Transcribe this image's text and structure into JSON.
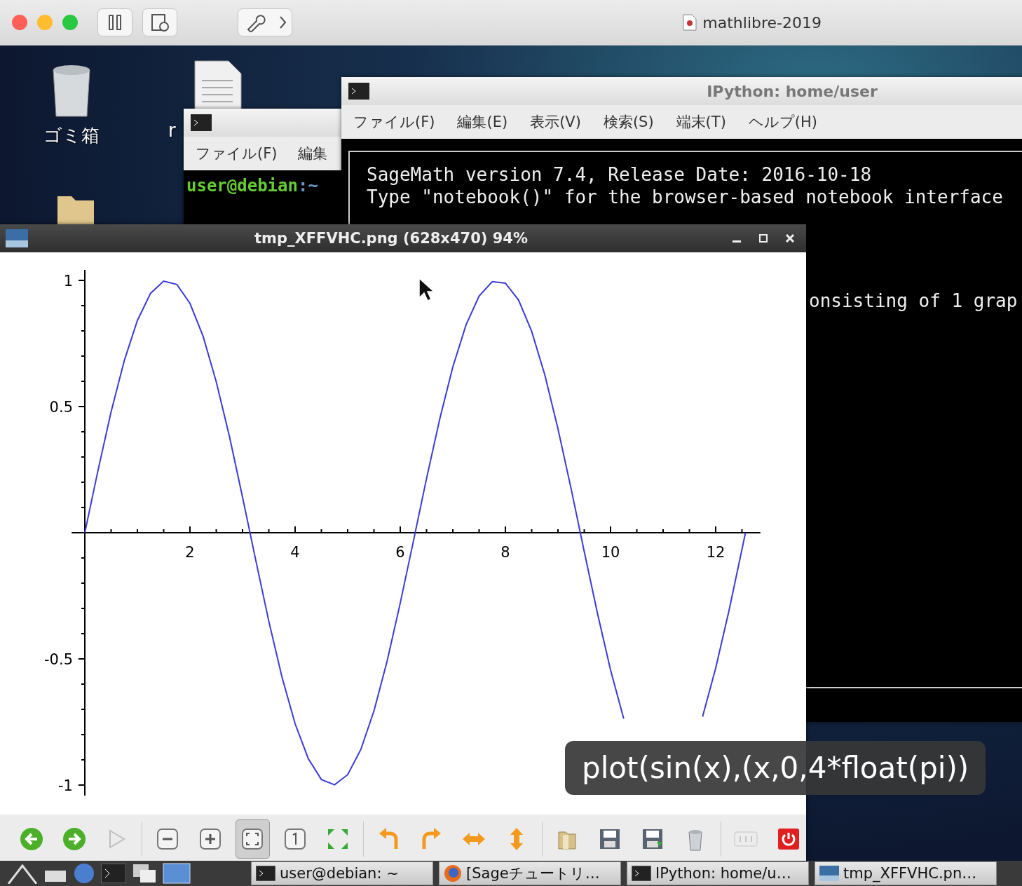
{
  "host_toolbar": {
    "title": "mathlibre-2019"
  },
  "desktop_icons": [
    {
      "kind": "trash",
      "label": "ゴミ箱"
    },
    {
      "kind": "document",
      "label": "r"
    },
    {
      "kind": "folder"
    }
  ],
  "small_terminal": {
    "menus": [
      "ファイル(F)",
      "編集"
    ],
    "prompt_user": "user@debian",
    "prompt_path": ":~"
  },
  "ipython_window": {
    "title": "IPython: home/user",
    "menus": [
      "ファイル(F)",
      "編集(E)",
      "表示(V)",
      "検索(S)",
      "端末(T)",
      "ヘルプ(H)"
    ],
    "lines": [
      "SageMath version 7.4, Release Date: 2016-10-18",
      "Type \"notebook()\" for the browser-based notebook interface"
    ],
    "partial_line": "onsisting of 1 grap"
  },
  "image_viewer": {
    "title": "tmp_XFFVHC.png (628x470) 94%",
    "chart_data": {
      "type": "line",
      "xlim": [
        -0.25,
        12.85
      ],
      "ylim": [
        -1.042,
        1.042
      ],
      "xticks": [
        2,
        4,
        6,
        8,
        10,
        12
      ],
      "yticks": [
        -1,
        -0.5,
        0.5,
        1
      ],
      "x": [
        0,
        0.25,
        0.5,
        0.75,
        1,
        1.25,
        1.5,
        1.75,
        2,
        2.25,
        2.5,
        2.75,
        3,
        3.25,
        3.5,
        3.75,
        4,
        4.25,
        4.5,
        4.75,
        5,
        5.25,
        5.5,
        5.75,
        6,
        6.25,
        6.5,
        6.75,
        7,
        7.25,
        7.5,
        7.75,
        8,
        8.25,
        8.5,
        8.75,
        9,
        9.25,
        9.5,
        9.75,
        10,
        10.25,
        10.5,
        10.75,
        11,
        11.25,
        11.5,
        11.75,
        12,
        12.25,
        12.5,
        12.566
      ],
      "series": [
        {
          "color": "#3b3bd6",
          "values": [
            0,
            0.247,
            0.479,
            0.682,
            0.841,
            0.949,
            0.997,
            0.984,
            0.909,
            0.778,
            0.598,
            0.382,
            0.141,
            -0.108,
            -0.351,
            -0.572,
            -0.757,
            -0.895,
            -0.978,
            -0.999,
            -0.959,
            -0.859,
            -0.706,
            -0.508,
            -0.279,
            -0.033,
            0.215,
            0.45,
            0.657,
            0.823,
            0.938,
            0.995,
            0.989,
            0.922,
            0.798,
            0.625,
            0.412,
            0.174,
            -0.075,
            -0.319,
            -0.544,
            -0.737,
            null,
            null,
            null,
            null,
            null,
            -0.729,
            -0.537,
            -0.311,
            -0.066,
            0
          ]
        }
      ]
    },
    "toolbar": [
      {
        "kind": "back",
        "selected": false,
        "disabled": false
      },
      {
        "kind": "forward",
        "selected": false,
        "disabled": false
      },
      {
        "kind": "play",
        "selected": false,
        "disabled": true
      },
      {
        "kind": "zoom-out",
        "selected": false,
        "disabled": false
      },
      {
        "kind": "zoom-in",
        "selected": false,
        "disabled": false
      },
      {
        "kind": "fit",
        "selected": true,
        "disabled": false
      },
      {
        "kind": "actual-size",
        "selected": false,
        "disabled": false
      },
      {
        "kind": "fullscreen",
        "selected": false,
        "disabled": false
      },
      {
        "kind": "rotate-left",
        "selected": false,
        "disabled": false
      },
      {
        "kind": "rotate-right",
        "selected": false,
        "disabled": false
      },
      {
        "kind": "flip-horizontal",
        "selected": false,
        "disabled": false
      },
      {
        "kind": "flip-vertical",
        "selected": false,
        "disabled": false
      },
      {
        "kind": "open",
        "selected": false,
        "disabled": false
      },
      {
        "kind": "save",
        "selected": false,
        "disabled": false
      },
      {
        "kind": "save-as",
        "selected": false,
        "disabled": false
      },
      {
        "kind": "delete",
        "selected": false,
        "disabled": false
      },
      {
        "kind": "preferences",
        "selected": false,
        "disabled": true
      },
      {
        "kind": "quit",
        "selected": false,
        "disabled": false
      }
    ]
  },
  "caption": "plot(sin(x),(x,0,4*float(pi))",
  "taskbar": {
    "tasks": [
      {
        "kind": "terminal",
        "label": "user@debian: ~"
      },
      {
        "kind": "browser",
        "label": "[Sageチュートリ…"
      },
      {
        "kind": "terminal",
        "label": "IPython: home/u…"
      },
      {
        "kind": "image",
        "label": "tmp_XFFVHC.pn…"
      }
    ]
  }
}
